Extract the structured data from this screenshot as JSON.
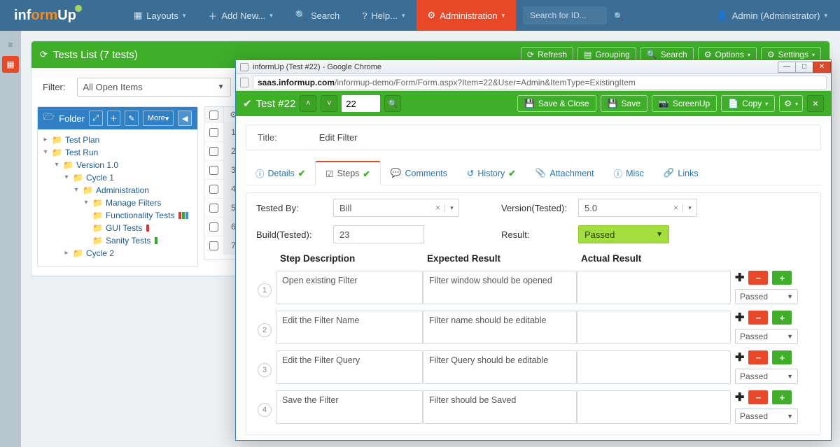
{
  "topnav": {
    "logo_a": "inf",
    "logo_b": "orm",
    "logo_c": "Up",
    "layouts": "Layouts",
    "add_new": "Add New...",
    "search": "Search",
    "help": "Help...",
    "admin": "Administration",
    "search_ph": "Search for ID...",
    "user_label": "Admin (Administrator)"
  },
  "tests_panel": {
    "title": "Tests List  (7 tests)",
    "btn_refresh": "Refresh",
    "btn_grouping": "Grouping",
    "btn_search": "Search",
    "btn_options": "Options",
    "btn_settings": "Settings",
    "filter_label": "Filter:",
    "filter_value": "All Open Items"
  },
  "folder": {
    "title": "Folder",
    "more": "More",
    "tree": {
      "test_plan": "Test Plan",
      "test_run": "Test Run",
      "version": "Version 1.0",
      "cycle1": "Cycle 1",
      "admin": "Administration",
      "manage": "Manage Filters",
      "func": "Functionality Tests",
      "gui": "GUI Tests",
      "sanity": "Sanity Tests",
      "cycle2": "Cycle 2"
    }
  },
  "grid": {
    "rows": [
      "1",
      "2",
      "3",
      "4",
      "5",
      "6",
      "7"
    ]
  },
  "chrome": {
    "title": "informUp (Test #22) - Google Chrome",
    "url_host": "saas.informup.com",
    "url_rest": "/informup-demo/Form/Form.aspx?Item=22&User=Admin&ItemType=ExistingItem"
  },
  "form": {
    "head_title": "Test #22",
    "idval": "22",
    "btn_save_close": "Save & Close",
    "btn_save": "Save",
    "btn_screenup": "ScreenUp",
    "btn_copy": "Copy",
    "title_label": "Title:",
    "title_value": "Edit Filter",
    "tabs": {
      "details": "Details",
      "steps": "Steps",
      "comments": "Comments",
      "history": "History",
      "attachment": "Attachment",
      "misc": "Misc",
      "links": "Links"
    },
    "tested_by_label": "Tested By:",
    "tested_by": "Bill",
    "build_label": "Build(Tested):",
    "build": "23",
    "version_label": "Version(Tested):",
    "version": "5.0",
    "result_label": "Result:",
    "result": "Passed",
    "col_step": "Step Description",
    "col_expected": "Expected Result",
    "col_actual": "Actual Result",
    "steps": [
      {
        "desc": "Open existing Filter",
        "expected": "Filter window should be opened",
        "actual": "",
        "result": "Passed"
      },
      {
        "desc": "Edit the Filter Name",
        "expected": "Filter name should be editable",
        "actual": "",
        "result": "Passed"
      },
      {
        "desc": "Edit the Filter Query",
        "expected": "Filter Query should be editable",
        "actual": "",
        "result": "Passed"
      },
      {
        "desc": "Save the Filter",
        "expected": "Filter should be Saved",
        "actual": "",
        "result": "Passed"
      }
    ]
  }
}
